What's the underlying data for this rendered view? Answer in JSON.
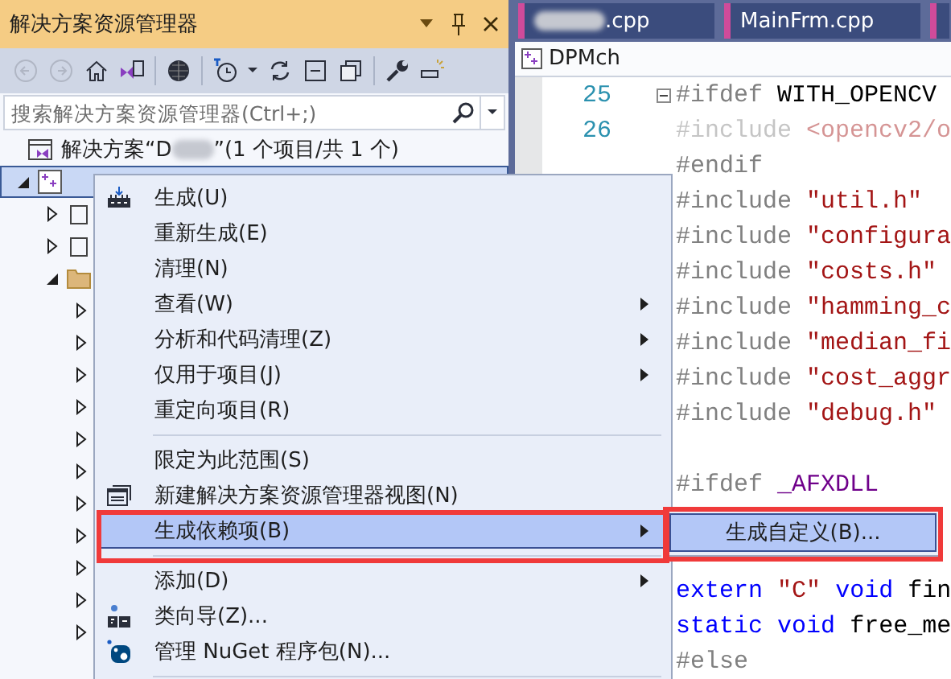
{
  "explorer": {
    "title": "解决方案资源管理器",
    "toolbar": [
      {
        "kind": "back",
        "disabled": true
      },
      {
        "kind": "forward",
        "disabled": true
      },
      {
        "kind": "home",
        "disabled": false
      },
      {
        "kind": "switch-views",
        "disabled": false
      },
      {
        "kind": "globe",
        "disabled": false
      },
      {
        "kind": "history",
        "disabled": false
      },
      {
        "kind": "refresh",
        "disabled": false
      },
      {
        "kind": "collapse",
        "disabled": false
      },
      {
        "kind": "copy",
        "disabled": false
      },
      {
        "kind": "wrench",
        "disabled": false
      },
      {
        "kind": "preview",
        "disabled": false
      }
    ],
    "search": {
      "placeholder": "搜索解决方案资源管理器(Ctrl+;)"
    },
    "tree": [
      {
        "label_start": "解决方案“D",
        "label_end": "”(1 个项目/共 1 个)",
        "selected": false,
        "children": [
          {
            "selected": true,
            "expanded": true,
            "children": [
              {
                "expanded": false,
                "selected": false
              },
              {
                "expanded": false,
                "selected": false
              },
              {
                "expanded": true,
                "selected": false,
                "children": [
                  {
                    "expanded": false,
                    "selected": false
                  },
                  {
                    "expanded": false,
                    "selected": false
                  },
                  {
                    "expanded": false,
                    "selected": false
                  },
                  {
                    "expanded": false,
                    "selected": false
                  },
                  {
                    "expanded": false,
                    "selected": false
                  },
                  {
                    "expanded": false,
                    "selected": false
                  },
                  {
                    "expanded": false,
                    "selected": false
                  },
                  {
                    "expanded": false,
                    "selected": false
                  },
                  {
                    "expanded": false,
                    "selected": false
                  },
                  {
                    "expanded": false,
                    "selected": false
                  },
                  {
                    "expanded": false,
                    "selected": false
                  }
                ]
              }
            ]
          }
        ]
      }
    ]
  },
  "editor": {
    "tabs": [
      {
        "label": ".cpp",
        "redacted": true
      },
      {
        "label": "MainFrm.cpp",
        "redacted": false
      }
    ],
    "breadcrumb": "DPMch",
    "lines": [
      {
        "kind": "code",
        "number": "25",
        "fold": true,
        "inactive": false,
        "tokens": [
          {
            "kind": "directive",
            "text": "#ifdef"
          },
          {
            "kind": "plain",
            "text": "WITH_OPENCV"
          }
        ]
      },
      {
        "kind": "code",
        "number": "26",
        "fold": false,
        "inactive": true,
        "tokens": [
          {
            "kind": "directive",
            "text": "#include"
          },
          {
            "kind": "string",
            "text": "<opencv2/o"
          }
        ]
      },
      {
        "kind": "code",
        "inactive": false,
        "tokens": [
          {
            "kind": "directive",
            "text": "#endif"
          }
        ]
      },
      {
        "kind": "code",
        "inactive": false,
        "tokens": [
          {
            "kind": "directive",
            "text": "#include"
          },
          {
            "kind": "string",
            "text": "\"util.h\""
          }
        ]
      },
      {
        "kind": "code",
        "inactive": false,
        "tokens": [
          {
            "kind": "directive",
            "text": "#include"
          },
          {
            "kind": "string",
            "text": "\"configura"
          }
        ]
      },
      {
        "kind": "code",
        "inactive": false,
        "tokens": [
          {
            "kind": "directive",
            "text": "#include"
          },
          {
            "kind": "string",
            "text": "\"costs.h\""
          }
        ]
      },
      {
        "kind": "code",
        "inactive": false,
        "tokens": [
          {
            "kind": "directive",
            "text": "#include"
          },
          {
            "kind": "string",
            "text": "\"hamming_c"
          }
        ]
      },
      {
        "kind": "code",
        "inactive": false,
        "tokens": [
          {
            "kind": "directive",
            "text": "#include"
          },
          {
            "kind": "string",
            "text": "\"median_fi"
          }
        ]
      },
      {
        "kind": "code",
        "inactive": false,
        "tokens": [
          {
            "kind": "directive",
            "text": "#include"
          },
          {
            "kind": "string",
            "text": "\"cost_aggr"
          }
        ]
      },
      {
        "kind": "code",
        "inactive": false,
        "tokens": [
          {
            "kind": "directive",
            "text": "#include"
          },
          {
            "kind": "string",
            "text": "\"debug.h\""
          }
        ]
      },
      {
        "kind": "blank"
      },
      {
        "kind": "code",
        "inactive": false,
        "tokens": [
          {
            "kind": "directive",
            "text": "#ifdef"
          },
          {
            "kind": "macro",
            "text": "_AFXDLL"
          }
        ]
      },
      {
        "kind": "blank"
      },
      {
        "kind": "blank"
      },
      {
        "kind": "code",
        "inactive": false,
        "tokens": [
          {
            "kind": "keyword",
            "text": "extern"
          },
          {
            "kind": "string",
            "text": "\"C\""
          },
          {
            "kind": "keyword",
            "text": "void"
          },
          {
            "kind": "plain",
            "text": "fin"
          }
        ]
      },
      {
        "kind": "code",
        "inactive": false,
        "tokens": [
          {
            "kind": "keyword",
            "text": "static"
          },
          {
            "kind": "keyword",
            "text": "void"
          },
          {
            "kind": "plain",
            "text": "free_me"
          }
        ]
      },
      {
        "kind": "code",
        "inactive": false,
        "tokens": [
          {
            "kind": "directive",
            "text": "#else"
          }
        ]
      }
    ]
  },
  "context_menu": {
    "items": [
      {
        "kind": "item",
        "label": "生成(U)",
        "has_submenu": false,
        "selected": false
      },
      {
        "kind": "item",
        "label": "重新生成(E)",
        "has_submenu": false,
        "selected": false
      },
      {
        "kind": "item",
        "label": "清理(N)",
        "has_submenu": false,
        "selected": false
      },
      {
        "kind": "item",
        "label": "查看(W)",
        "has_submenu": true,
        "selected": false
      },
      {
        "kind": "item",
        "label": "分析和代码清理(Z)",
        "has_submenu": true,
        "selected": false
      },
      {
        "kind": "item",
        "label": "仅用于项目(J)",
        "has_submenu": true,
        "selected": false
      },
      {
        "kind": "item",
        "label": "重定向项目(R)",
        "has_submenu": false,
        "selected": false
      },
      {
        "kind": "separator"
      },
      {
        "kind": "item",
        "label": "限定为此范围(S)",
        "has_submenu": false,
        "selected": false
      },
      {
        "kind": "item",
        "label": "新建解决方案资源管理器视图(N)",
        "has_submenu": false,
        "selected": false
      },
      {
        "kind": "item",
        "label": "生成依赖项(B)",
        "has_submenu": true,
        "selected": true
      },
      {
        "kind": "separator"
      },
      {
        "kind": "item",
        "label": "添加(D)",
        "has_submenu": true,
        "selected": false
      },
      {
        "kind": "item",
        "label": "类向导(Z)...",
        "has_submenu": false,
        "selected": false
      },
      {
        "kind": "item",
        "label": "管理 NuGet 程序包(N)...",
        "has_submenu": false,
        "selected": false
      },
      {
        "kind": "separator"
      }
    ]
  },
  "submenu": {
    "items": [
      {
        "label": "生成自定义(B)...",
        "selected": true
      }
    ]
  }
}
